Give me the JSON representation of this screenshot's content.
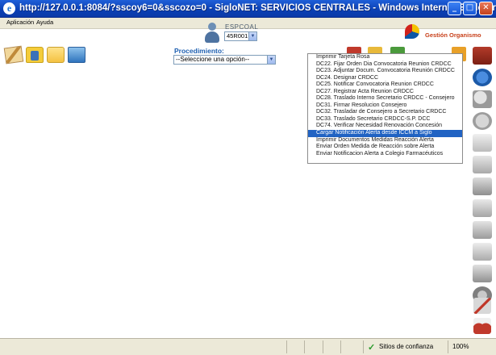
{
  "window": {
    "title": "http://127.0.0.1:8084/?sscoy6=0&sscozo=0 - SigloNET: SERVICIOS CENTRALES - Windows Internet Explorer",
    "minimize": "_",
    "maximize": "□",
    "close": "✕"
  },
  "menu": {
    "items": [
      "Aplicación",
      "Ayuda"
    ]
  },
  "header": {
    "espc_label": "ESPCOAL",
    "espc_value": "45R001",
    "org_label": "Gestión Organismo"
  },
  "procedure": {
    "label": "Procedimiento:",
    "selected": "--Seleccione una opción--",
    "options": [
      "Imprimir Tarjeta Rosa",
      "DC22. Fijar Orden Dia Convocatoria Reunion CRDCC",
      "DC23. Adjuntar Docum. Convocatoria Reunión CRDCC",
      "DC24. Designar CRDCC",
      "DC25. Notificar Convocatoria Reunion CRDCC",
      "DC27. Registrar Acta Reunion CRDCC",
      "DC28. Traslado Interno Secretario CRDCC - Consejero",
      "DC31. Firmar Resolucion Consejero",
      "DC32. Trasladar de Consejero a Secretario CRDCC",
      "DC33. Traslado Secretario CRDCC-S.P. DCC",
      "DC74. Verificar Necesidad Renovación Concesión",
      "Cargar Notificación Alerta desde ICCM a Siglo",
      "Imprimir Documentos Medidas Reacción Alerta",
      "Enviar Orden Medida de Reacción sobre Alerta",
      "Enviar Notificacion Alerta a Colegio Farmacéuticos"
    ],
    "highlighted_index": 11
  },
  "statusbar": {
    "zone": "Sitios de confianza",
    "zoom": "100%"
  },
  "colors": {
    "title_bar": "#0a3fb4",
    "selection": "#2163c3",
    "proc_label": "#1d5fb1"
  }
}
